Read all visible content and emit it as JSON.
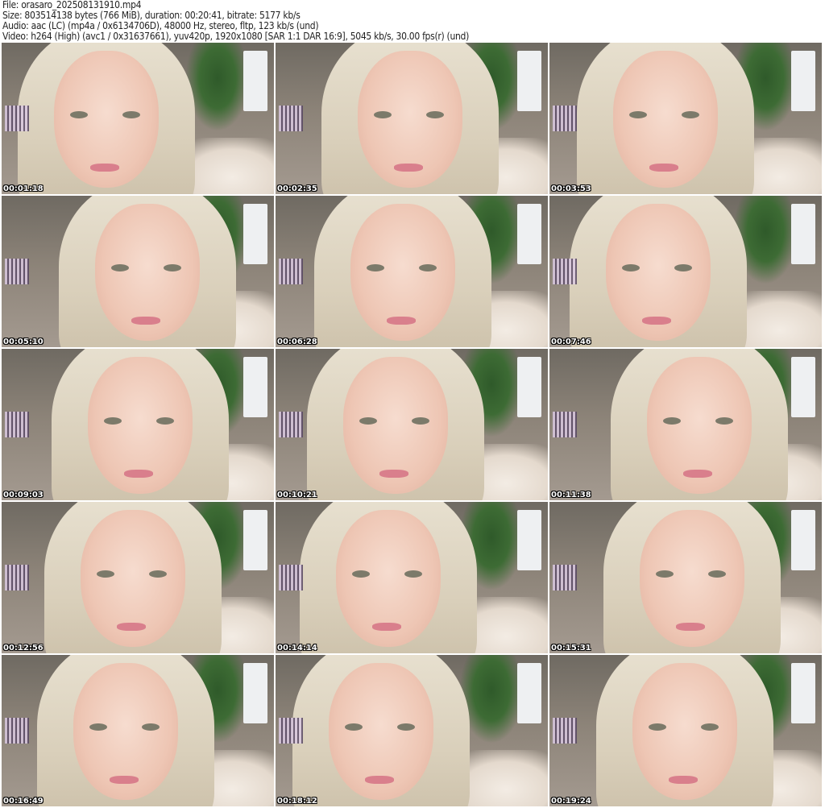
{
  "header": {
    "file": "File: orasaro_202508131910.mp4",
    "size": "Size: 803514138 bytes (766 MiB), duration: 00:20:41, bitrate: 5177 kb/s",
    "audio": "Audio: aac (LC) (mp4a / 0x6134706D), 48000 Hz, stereo, fltp, 123 kb/s (und)",
    "video": "Video: h264 (High) (avc1 / 0x31637661), yuv420p, 1920x1080 [SAR 1:1 DAR 16:9], 5045 kb/s, 30.00 fps(r) (und)"
  },
  "thumbnails": [
    {
      "timestamp": "00:01:18"
    },
    {
      "timestamp": "00:02:35"
    },
    {
      "timestamp": "00:03:53"
    },
    {
      "timestamp": "00:05:10"
    },
    {
      "timestamp": "00:06:28"
    },
    {
      "timestamp": "00:07:46"
    },
    {
      "timestamp": "00:09:03"
    },
    {
      "timestamp": "00:10:21"
    },
    {
      "timestamp": "00:11:38"
    },
    {
      "timestamp": "00:12:56"
    },
    {
      "timestamp": "00:14:14"
    },
    {
      "timestamp": "00:15:31"
    },
    {
      "timestamp": "00:16:49"
    },
    {
      "timestamp": "00:18:12"
    },
    {
      "timestamp": "00:19:24"
    }
  ]
}
